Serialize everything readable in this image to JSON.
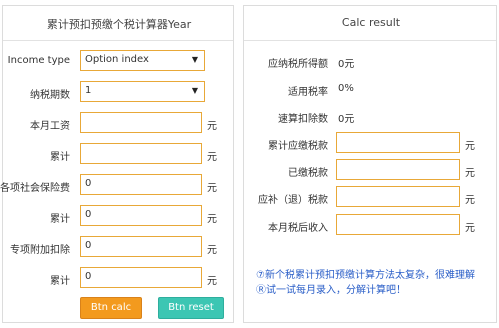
{
  "left": {
    "title": "累计预扣预缴个税计算器Year",
    "income_type": {
      "label": "Income type",
      "value": "Option index"
    },
    "tax_period": {
      "label": "纳税期数",
      "value": "1"
    },
    "monthly_salary": {
      "label": "本月工资",
      "value": "",
      "unit": "元"
    },
    "cumulative_1": {
      "label": "累计",
      "value": "",
      "unit": "元"
    },
    "social_insurance": {
      "label": "各项社会保险费",
      "value": "0",
      "unit": "元"
    },
    "cumulative_2": {
      "label": "累计",
      "value": "0",
      "unit": "元"
    },
    "special_deduction": {
      "label": "专项附加扣除",
      "value": "0",
      "unit": "元"
    },
    "cumulative_3": {
      "label": "累计",
      "value": "0",
      "unit": "元"
    },
    "buttons": {
      "calc": "Btn calc",
      "reset": "Btn reset"
    }
  },
  "right": {
    "title": "Calc result",
    "taxable_income": {
      "label": "应纳税所得额",
      "value": "0元"
    },
    "tax_rate": {
      "label": "适用税率",
      "value": "0%"
    },
    "quick_deduction": {
      "label": "速算扣除数",
      "value": "0元"
    },
    "cumulative_tax_due": {
      "label": "累计应缴税款",
      "value": "",
      "unit": "元"
    },
    "tax_paid": {
      "label": "已缴税款",
      "value": "",
      "unit": "元"
    },
    "tax_refund": {
      "label": "应补（退）税款",
      "value": "",
      "unit": "元"
    },
    "after_tax_income": {
      "label": "本月税后收入",
      "value": "",
      "unit": "元"
    },
    "note_line1": "⑦新个税累计预扣预缴计算方法太复杂，很难理解",
    "note_line2": "Ⓡ试一试每月录入，分解计算吧！"
  }
}
